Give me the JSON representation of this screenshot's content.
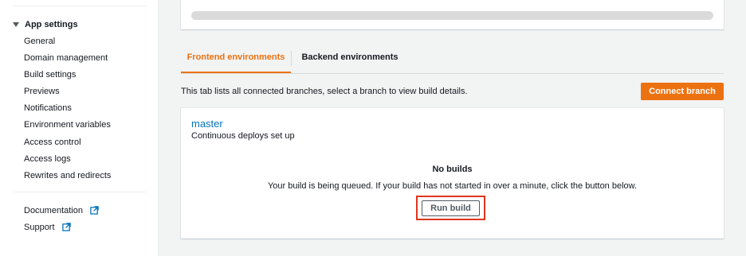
{
  "sidebar": {
    "section_title": "App settings",
    "items": [
      {
        "label": "General"
      },
      {
        "label": "Domain management"
      },
      {
        "label": "Build settings"
      },
      {
        "label": "Previews"
      },
      {
        "label": "Notifications"
      },
      {
        "label": "Environment variables"
      },
      {
        "label": "Access control"
      },
      {
        "label": "Access logs"
      },
      {
        "label": "Rewrites and redirects"
      }
    ],
    "external_links": [
      {
        "label": "Documentation",
        "icon": "external-link-icon"
      },
      {
        "label": "Support",
        "icon": "external-link-icon"
      }
    ]
  },
  "tabs": {
    "frontend": "Frontend environments",
    "backend": "Backend environments",
    "active": "frontend"
  },
  "tab_description": "This tab lists all connected branches, select a branch to view build details.",
  "connect_branch_label": "Connect branch",
  "branch": {
    "name": "master",
    "status": "Continuous deploys set up",
    "empty_title": "No builds",
    "empty_message": "Your build is being queued. If your build has not started in over a minute, click the button below.",
    "run_build_label": "Run build"
  },
  "colors": {
    "accent": "#ec7211",
    "link": "#0073bb",
    "highlight": "#e0351e"
  }
}
